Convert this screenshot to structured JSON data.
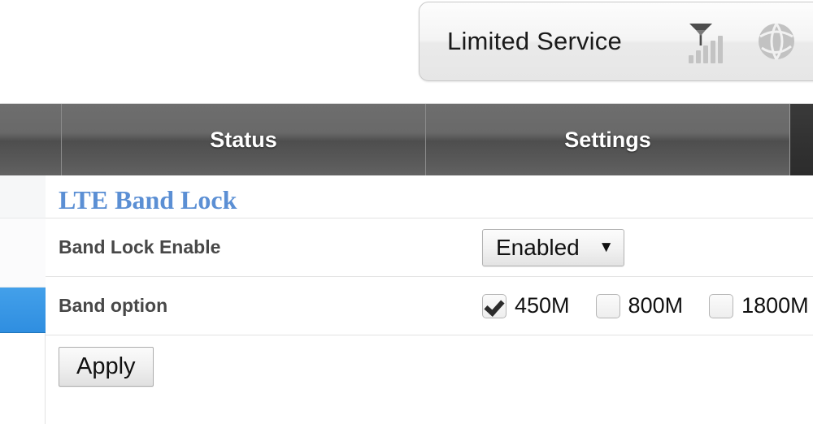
{
  "header": {
    "status_panel": {
      "service_text": "Limited Service",
      "icons": [
        {
          "name": "signal-antenna-icon",
          "bars": 5
        },
        {
          "name": "globe-network-icon"
        },
        {
          "name": "battery-shield-icon",
          "color": "#1a7fd4"
        }
      ]
    }
  },
  "navbar": {
    "tabs": [
      {
        "label": "",
        "active": false
      },
      {
        "label": "Status",
        "active": false
      },
      {
        "label": "Settings",
        "active": false
      },
      {
        "label": "",
        "active": true
      }
    ]
  },
  "sidebar": {
    "items": [
      {
        "label": "",
        "selected": false
      },
      {
        "label": "",
        "selected": false
      },
      {
        "label": "",
        "selected": true
      }
    ],
    "selected_color": "#2f8ee0"
  },
  "content": {
    "section_title": "LTE Band Lock",
    "title_color": "#5b8fd4",
    "rows": [
      {
        "label": "Band Lock Enable",
        "control": "select",
        "value": "Enabled",
        "caret": "▼"
      },
      {
        "label": "Band option",
        "control": "checkboxes",
        "options": [
          {
            "label": "450M",
            "checked": true
          },
          {
            "label": "800M",
            "checked": false
          },
          {
            "label": "1800M",
            "checked": false
          }
        ]
      }
    ],
    "apply_label": "Apply"
  }
}
